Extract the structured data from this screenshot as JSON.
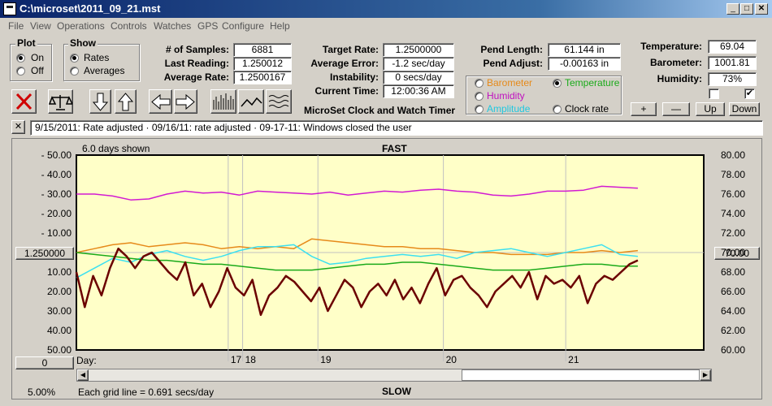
{
  "window": {
    "title": "C:\\microset\\2011_09_21.mst"
  },
  "menu": [
    "File",
    "View",
    "Operations",
    "Controls",
    "Watches",
    "GPS",
    "Configure",
    "Help"
  ],
  "plot": {
    "title": "Plot",
    "on": "On",
    "off": "Off",
    "selected": "On"
  },
  "show": {
    "title": "Show",
    "rates": "Rates",
    "averages": "Averages",
    "selected": "Rates"
  },
  "stats": {
    "samples_label": "# of Samples:",
    "samples": "6881",
    "last_label": "Last Reading:",
    "last": "1.250012",
    "avg_label": "Average Rate:",
    "avg": "1.2500167"
  },
  "targets": {
    "target_label": "Target Rate:",
    "target": "1.2500000",
    "avg_err_label": "Average Error:",
    "avg_err": "-1.2 sec/day",
    "instab_label": "Instability:",
    "instab": "0 secs/day",
    "time_label": "Current Time:",
    "time": "12:00:36 AM",
    "app_name": "MicroSet Clock and Watch Timer"
  },
  "pend": {
    "length_label": "Pend Length:",
    "length": "61.144 in",
    "adjust_label": "Pend Adjust:",
    "adjust": "-0.00163 in"
  },
  "series_select": {
    "barometer": "Barometer",
    "temperature": "Temperature",
    "humidity": "Humidity",
    "amplitude": "Amplitude",
    "clock_rate": "Clock rate",
    "selected": "Temperature"
  },
  "env": {
    "temp_label": "Temperature:",
    "temp": "69.04",
    "baro_label": "Barometer:",
    "baro": "1001.81",
    "hum_label": "Humidity:",
    "hum": "73%",
    "check1": false,
    "check2": true,
    "plus": "+",
    "minus": "—",
    "up": "Up",
    "down": "Down"
  },
  "notes": {
    "text": "9/15/2011: Rate adjusted · 09/16/11: rate adjusted · 09-17-11: Windows closed the user",
    "close": "✕"
  },
  "chart_header": {
    "days_shown": "6.0 days shown",
    "fast": "FAST",
    "slow": "SLOW"
  },
  "chart_footer": {
    "grid_line": "Each grid line = 0.691 secs/day",
    "percent": "5.00%",
    "day_label": "Day:"
  },
  "left_box": "1.250000",
  "right_box": "70.00",
  "bottom_left_box": "0",
  "colors": {
    "plot_bg": "#ffffc8",
    "rate": "#6b0000",
    "temperature": "#1aaa1a",
    "barometer": "#e68a1a",
    "humidity": "#d21ad2",
    "amplitude": "#3ce0f0",
    "grid": "#c0c0c0"
  },
  "chart_data": {
    "type": "line",
    "title": "",
    "left_ticks": [
      "- 50.00",
      "- 40.00",
      "- 30.00",
      "- 20.00",
      "- 10.00",
      "10.00",
      "20.00",
      "30.00",
      "40.00",
      "50.00"
    ],
    "left_ylim": [
      50,
      -50
    ],
    "right_ticks": [
      "80.00",
      "78.00",
      "76.00",
      "74.00",
      "72.00",
      "70.00",
      "68.00",
      "66.00",
      "64.00",
      "62.00",
      "60.00"
    ],
    "right_ylim": [
      60,
      80
    ],
    "x_day_ticks": [
      {
        "day": "17",
        "x": 0.242
      },
      {
        "day": "18",
        "x": 0.265
      },
      {
        "day": "19",
        "x": 0.385
      },
      {
        "day": "20",
        "x": 0.585
      },
      {
        "day": "21",
        "x": 0.78
      }
    ],
    "series": [
      {
        "name": "Humidity",
        "color": "#d21ad2",
        "values": [
          76,
          76,
          75.8,
          75.4,
          75.5,
          76.0,
          76.3,
          76.1,
          76.2,
          75.9,
          76.3,
          76.2,
          76.1,
          76.0,
          76.2,
          75.9,
          76.1,
          76.3,
          76.2,
          76.4,
          76.5,
          76.3,
          76.2,
          75.9,
          75.8,
          76.0,
          76.3,
          76.3,
          76.4,
          76.8,
          76.7,
          76.6
        ]
      },
      {
        "name": "Barometer",
        "color": "#e68a1a",
        "values": [
          0,
          2,
          4,
          5,
          3,
          4,
          5,
          4,
          2,
          3,
          2,
          3,
          2,
          7,
          6,
          5,
          4,
          3,
          3,
          2,
          2,
          1,
          0,
          0,
          -1,
          -1,
          -1,
          0,
          0,
          1,
          0,
          1
        ]
      },
      {
        "name": "Amplitude",
        "color": "#3ce0f0",
        "values": [
          -13,
          -8,
          -3,
          -5,
          -1,
          1,
          -2,
          -4,
          -2,
          1,
          3,
          3,
          4,
          -2,
          -6,
          -5,
          -3,
          -2,
          -1,
          -2,
          -1,
          -3,
          0,
          1,
          2,
          0,
          -2,
          0,
          2,
          4,
          -1,
          -2
        ]
      },
      {
        "name": "Temperature",
        "color": "#1aaa1a",
        "values": [
          0,
          -1,
          -2,
          -3,
          -4,
          -4,
          -5,
          -6,
          -6,
          -7,
          -8,
          -9,
          -9,
          -9,
          -8,
          -7,
          -6,
          -6,
          -5,
          -5,
          -6,
          -7,
          -8,
          -9,
          -9,
          -9,
          -8,
          -7,
          -6,
          -6,
          -7,
          -7
        ]
      },
      {
        "name": "Clock rate",
        "color": "#6b0000",
        "values": [
          -10,
          -28,
          -12,
          -22,
          -8,
          2,
          -2,
          -8,
          -2,
          0,
          -5,
          -10,
          -14,
          -5,
          -22,
          -16,
          -28,
          -20,
          -8,
          -18,
          -22,
          -14,
          -32,
          -22,
          -18,
          -12,
          -15,
          -20,
          -25,
          -18,
          -30,
          -22,
          -14,
          -18,
          -28,
          -20,
          -16,
          -22,
          -14,
          -24,
          -18,
          -26,
          -16,
          -8,
          -22,
          -14,
          -12,
          -18,
          -22,
          -28,
          -20,
          -16,
          -12,
          -18,
          -10,
          -24,
          -12,
          -16,
          -14,
          -18,
          -12,
          -26,
          -16,
          -12,
          -14,
          -10,
          -6,
          -4
        ]
      }
    ]
  }
}
